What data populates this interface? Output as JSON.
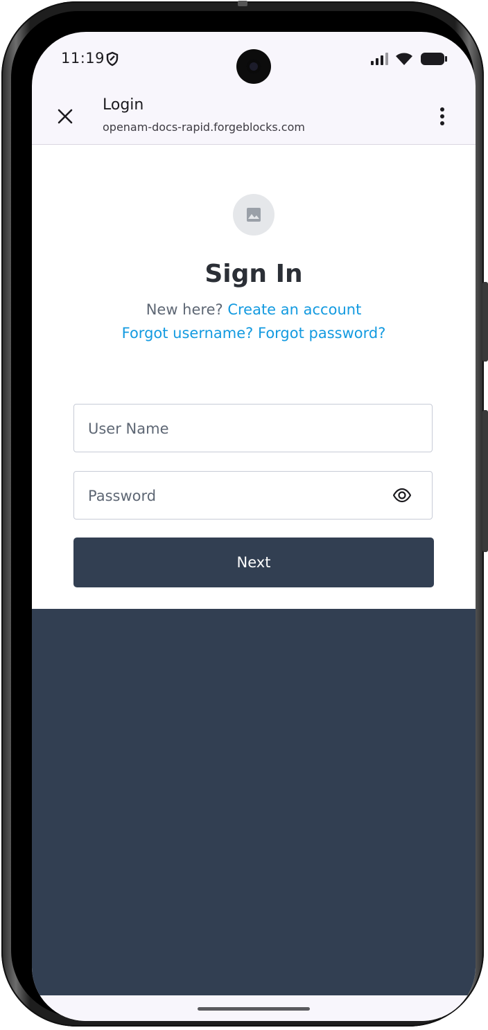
{
  "status": {
    "time": "11:19",
    "icons": [
      "shield-icon",
      "signal-icon",
      "wifi-icon",
      "battery-icon"
    ]
  },
  "browser": {
    "title": "Login",
    "url": "openam-docs-rapid.forgeblocks.com",
    "icons": [
      "close-icon",
      "more-vert-icon"
    ]
  },
  "signin": {
    "logo_icon": "image-placeholder-icon",
    "heading": "Sign In",
    "new_here": "New here?",
    "create_account": "Create an account",
    "forgot_username": "Forgot username?",
    "forgot_password": "Forgot password?",
    "username_placeholder": "User Name",
    "password_placeholder": "Password",
    "eye_icon": "eye-icon",
    "next_label": "Next"
  },
  "colors": {
    "link": "#139ae0",
    "button": "#323f52",
    "background_lower": "#323f52"
  }
}
